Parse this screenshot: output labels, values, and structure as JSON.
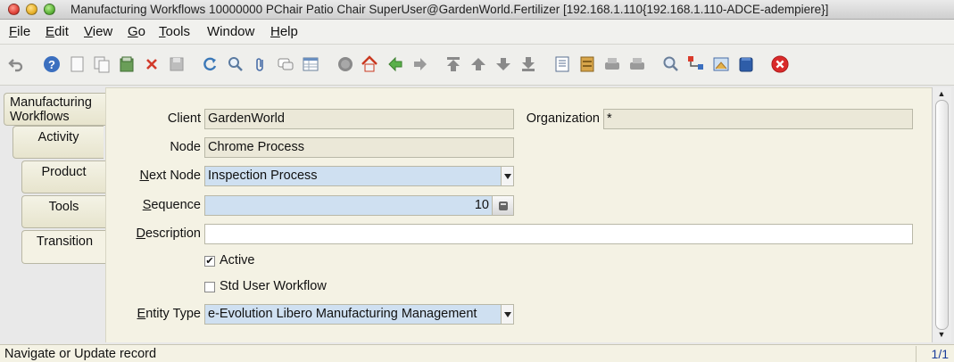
{
  "window": {
    "title": "Manufacturing Workflows  10000000  PChair  Patio Chair  SuperUser@GardenWorld.Fertilizer [192.168.1.110{192.168.1.110-ADCE-adempiere}]"
  },
  "menu": {
    "items": [
      {
        "mnemonic": "F",
        "rest": "ile"
      },
      {
        "mnemonic": "E",
        "rest": "dit"
      },
      {
        "mnemonic": "V",
        "rest": "iew"
      },
      {
        "mnemonic": "G",
        "rest": "o"
      },
      {
        "mnemonic": "T",
        "rest": "ools"
      },
      {
        "mnemonic": "",
        "rest": "Window"
      },
      {
        "mnemonic": "H",
        "rest": "elp"
      }
    ]
  },
  "toolbar": {
    "icons": [
      "undo-icon",
      "help-icon",
      "new-record-icon",
      "copy-record-icon",
      "save-icon",
      "delete-icon",
      "save-disabled-icon",
      "refresh-icon",
      "find-icon",
      "attachment-icon",
      "chat-icon",
      "grid-toggle-icon",
      "history-icon",
      "home-icon",
      "back-icon",
      "forward-icon",
      "first-record-icon",
      "previous-record-icon",
      "next-record-icon",
      "last-record-icon",
      "report-icon",
      "archive-icon",
      "print-preview-icon",
      "print-icon",
      "zoom-across-icon",
      "active-workflows-icon",
      "requests-icon",
      "product-info-icon",
      "exit-icon"
    ]
  },
  "tabs": {
    "items": [
      {
        "label": "Manufacturing Workflows"
      },
      {
        "label": "Activity"
      },
      {
        "label": "Product"
      },
      {
        "label": "Tools"
      },
      {
        "label": "Transition"
      }
    ],
    "active": "Transition"
  },
  "form": {
    "client": {
      "label": "Client",
      "value": "GardenWorld"
    },
    "organization": {
      "label": "Organization",
      "value": "*"
    },
    "node": {
      "label": "Node",
      "value": "Chrome Process"
    },
    "next_node": {
      "label_mnemonic": "N",
      "label_rest": "ext Node",
      "value": "Inspection Process"
    },
    "sequence": {
      "label_mnemonic": "S",
      "label_rest": "equence",
      "value": "10"
    },
    "description": {
      "label_mnemonic": "D",
      "label_rest": "escription",
      "value": ""
    },
    "active": {
      "label": "Active",
      "checked": true,
      "mark": "✔"
    },
    "std_user_workflow": {
      "label": "Std User Workflow",
      "checked": false
    },
    "entity_type": {
      "label_mnemonic": "E",
      "label_rest": "ntity Type",
      "value": "e-Evolution Libero Manufacturing Management"
    }
  },
  "status": {
    "message": "Navigate or Update record",
    "record_count": "1/1"
  },
  "colors": {
    "panel_bg": "#f4f2e4",
    "readonly_field": "#ebe8d8",
    "mandatory_field": "#cfe0f1",
    "record_count_text": "#1a3d9a"
  }
}
